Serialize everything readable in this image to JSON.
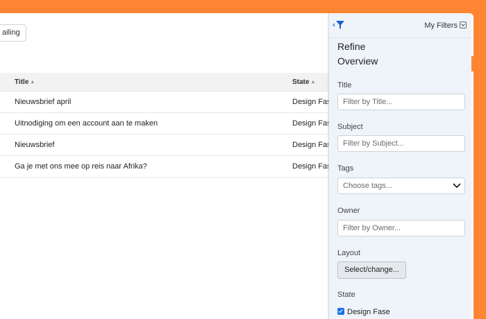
{
  "toolbar": {
    "mailing_label": "ailing"
  },
  "table": {
    "columns": [
      "Title",
      "State"
    ],
    "rows": [
      {
        "title": "Nieuwsbrief april",
        "state": "Design Fase"
      },
      {
        "title": "Uitnodiging om een account aan te maken",
        "state": "Design Fase"
      },
      {
        "title": "Nieuwsbrief",
        "state": "Design Fase"
      },
      {
        "title": "Ga je met ons mee op reis naar Afrika?",
        "state": "Design Fase"
      }
    ]
  },
  "filter_panel": {
    "my_filters": "My Filters",
    "title_line1": "Refine",
    "title_line2": "Overview",
    "title_label": "Title",
    "title_placeholder": "Filter by Title...",
    "subject_label": "Subject",
    "subject_placeholder": "Filter by Subject...",
    "tags_label": "Tags",
    "tags_placeholder": "Choose tags...",
    "owner_label": "Owner",
    "owner_placeholder": "Filter by Owner...",
    "layout_label": "Layout",
    "layout_button": "Select/change...",
    "state_label": "State",
    "state_option": "Design Fase"
  },
  "colors": {
    "accent": "#ff8533",
    "panel_bg": "#eef4f9",
    "filter_icon": "#1a5fd0",
    "checkbox": "#1a73e8"
  },
  "icons": [
    "collapse-filter-icon",
    "filter-icon",
    "dropdown-icon",
    "chevron-down-icon",
    "sort-icon",
    "checkbox-checked-icon"
  ]
}
